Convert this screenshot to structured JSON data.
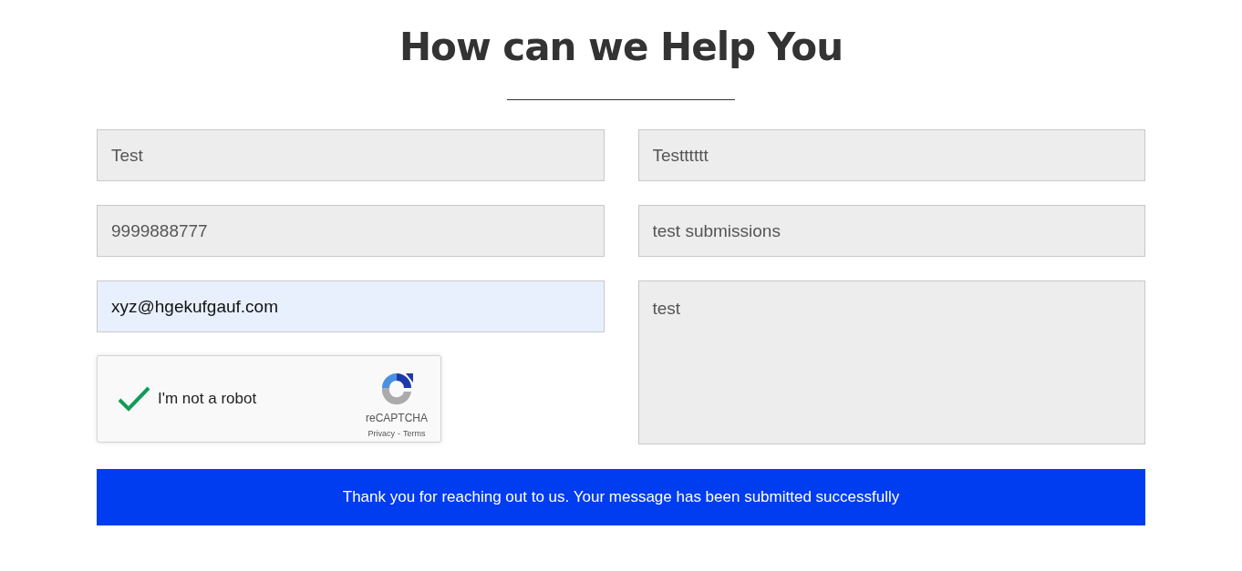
{
  "heading": "How can we Help You",
  "left_fields": [
    {
      "kind": "input",
      "value": "Test",
      "autofilled": false
    },
    {
      "kind": "input",
      "value": "9999888777",
      "autofilled": false
    },
    {
      "kind": "input",
      "value": "xyz@hgekufgauf.com",
      "autofilled": true
    }
  ],
  "right_fields": [
    {
      "kind": "input",
      "value": "Testttttt",
      "autofilled": false
    },
    {
      "kind": "input",
      "value": "test submissions",
      "autofilled": false
    },
    {
      "kind": "textarea",
      "value": "test",
      "autofilled": false
    }
  ],
  "captcha": {
    "label": "I'm not a robot",
    "checked": true,
    "brand": "reCAPTCHA",
    "privacy": "Privacy",
    "separator": "-",
    "terms": "Terms"
  },
  "success_message": "Thank you for reaching out to us. Your message has been submitted successfully"
}
